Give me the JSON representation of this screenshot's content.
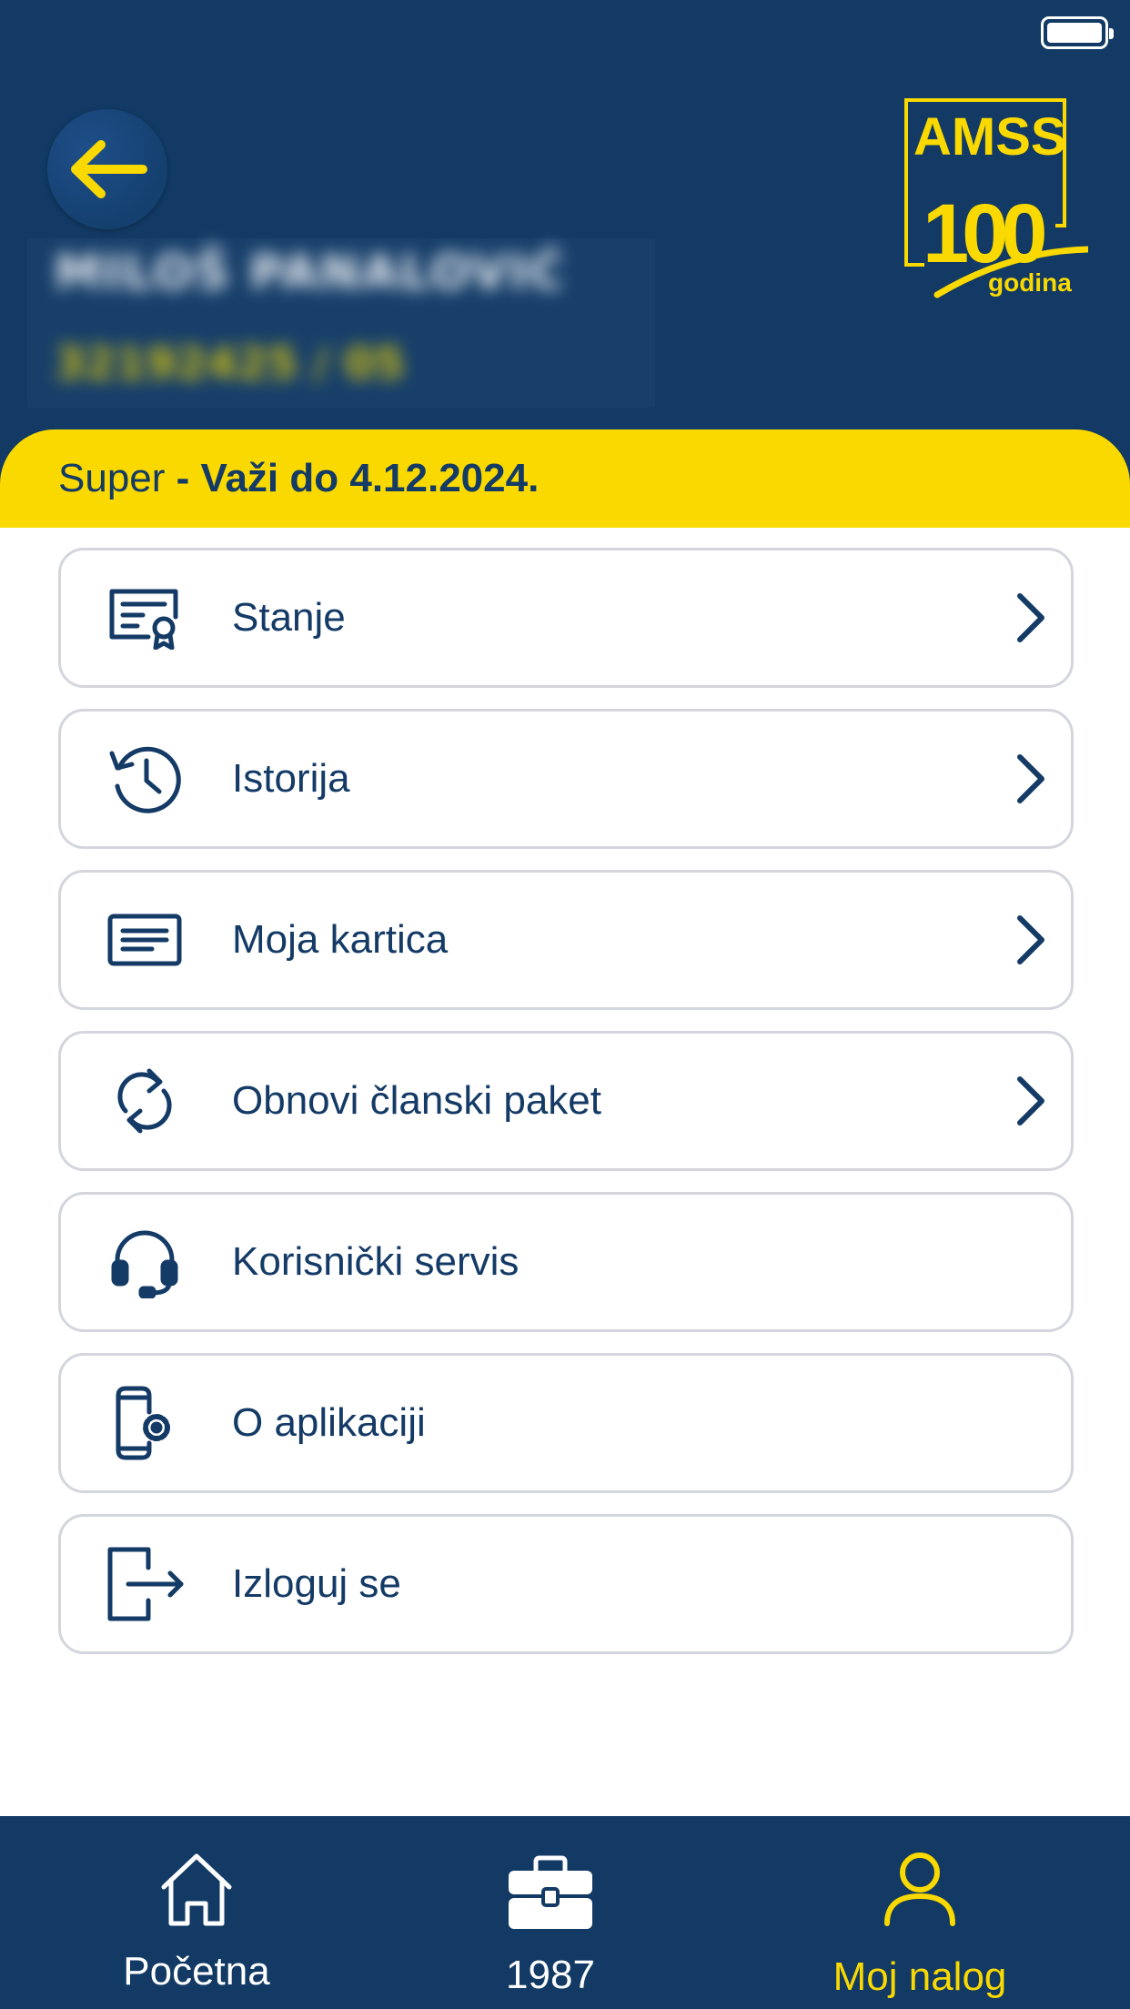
{
  "status_bar": {
    "battery_icon": "battery-full-icon"
  },
  "header": {
    "back_icon": "arrow-left-icon",
    "profile_name": "MILOŠ PANALOVIĆ",
    "profile_id": "32192425 / 05",
    "logo": {
      "brand": "AMSS",
      "number": "100",
      "subtitle": "godina"
    },
    "colors": {
      "background": "#123a64",
      "accent": "#f9d900"
    }
  },
  "membership": {
    "tier": "Super",
    "valid_until": " - Važi do 4.12.2024."
  },
  "menu": {
    "items": [
      {
        "label": "Stanje",
        "icon": "certificate-icon",
        "has_chevron": true
      },
      {
        "label": "Istorija",
        "icon": "history-icon",
        "has_chevron": true
      },
      {
        "label": "Moja kartica",
        "icon": "card-icon",
        "has_chevron": true
      },
      {
        "label": "Obnovi članski paket",
        "icon": "refresh-icon",
        "has_chevron": true
      },
      {
        "label": "Korisnički servis",
        "icon": "headset-icon",
        "has_chevron": false
      },
      {
        "label": "O aplikaciji",
        "icon": "phone-settings-icon",
        "has_chevron": false
      },
      {
        "label": "Izloguj se",
        "icon": "logout-icon",
        "has_chevron": false
      }
    ]
  },
  "tabbar": {
    "tabs": [
      {
        "label": "Početna",
        "icon": "home-icon",
        "active": false
      },
      {
        "label": "1987",
        "icon": "toolbox-icon",
        "active": false
      },
      {
        "label": "Moj nalog",
        "icon": "user-icon",
        "active": true
      }
    ],
    "colors": {
      "inactive": "#ffffff",
      "active": "#f9d900"
    }
  }
}
